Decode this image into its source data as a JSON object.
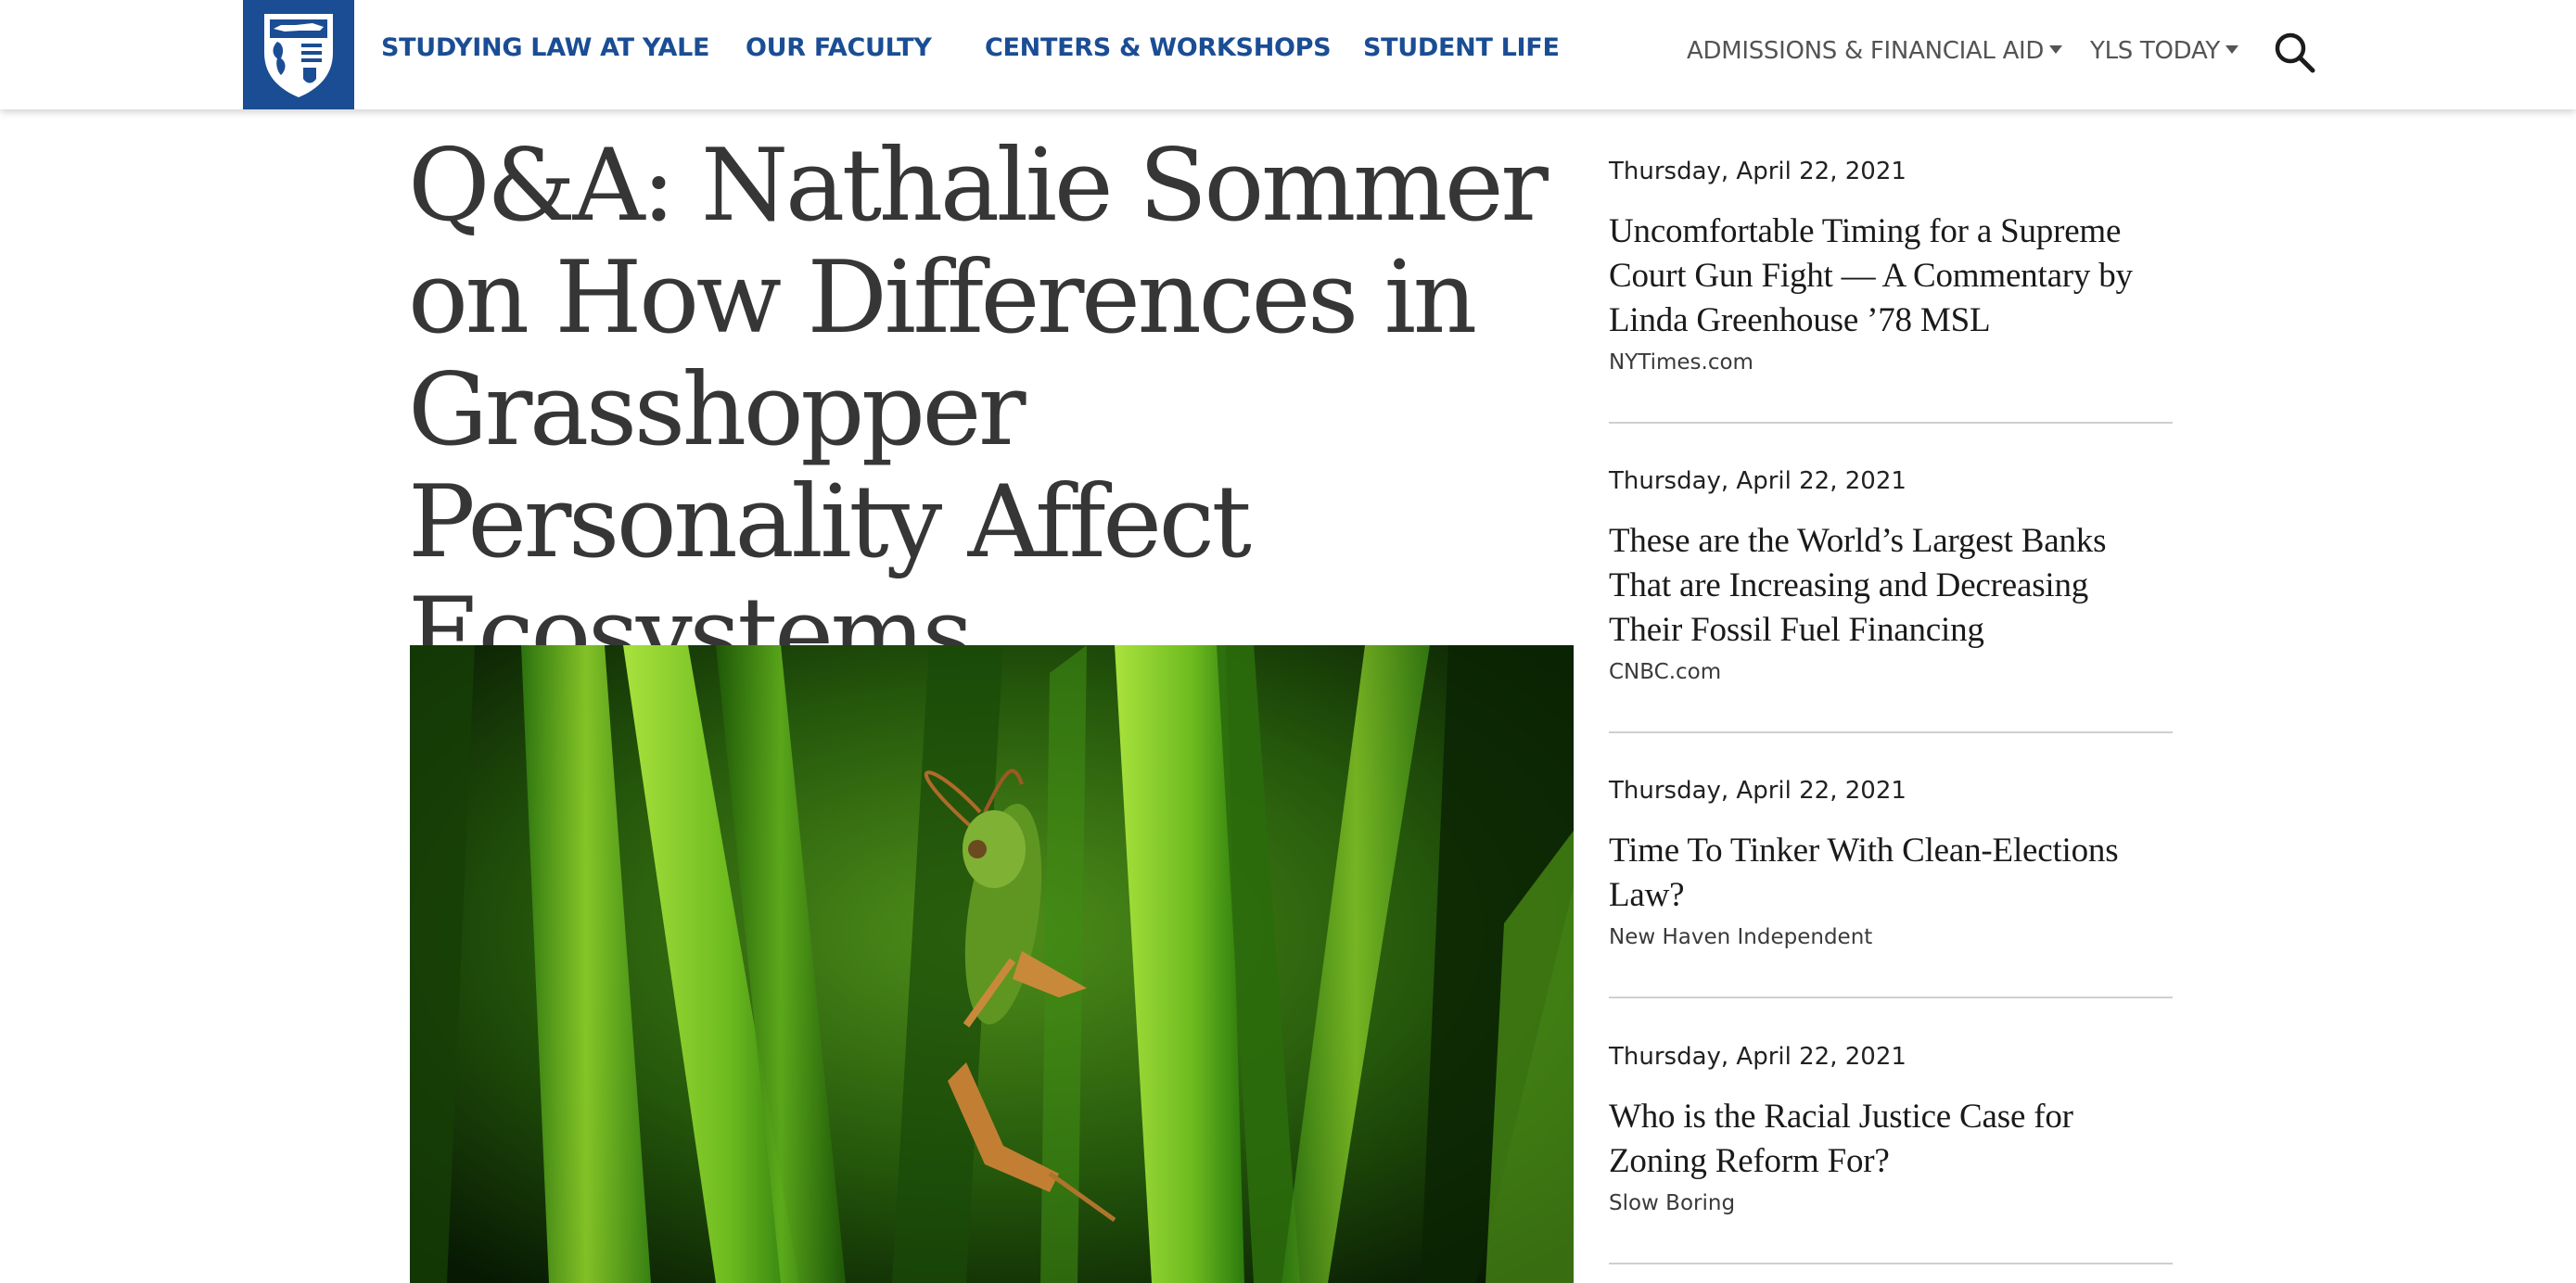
{
  "header": {
    "primary_nav": [
      {
        "label": "STUDYING LAW AT YALE"
      },
      {
        "label": "OUR FACULTY"
      },
      {
        "label": "CENTERS & WORKSHOPS"
      },
      {
        "label": "STUDENT LIFE"
      }
    ],
    "secondary_nav": [
      {
        "label": "ADMISSIONS & FINANCIAL AID",
        "icon": "chevron-down-icon"
      },
      {
        "label": "YLS TODAY",
        "icon": "chevron-down-icon"
      }
    ],
    "search_icon": "search-icon",
    "logo_icon": "yale-law-shield-icon",
    "colors": {
      "brand_blue": "#1a4d94",
      "secondary_text": "#545454"
    }
  },
  "article": {
    "title": "Q&A: Nathalie Sommer on How Differences in Grasshopper Personality Affect Ecosystems",
    "hero_image": "grasshopper-on-grass-photo"
  },
  "sidebar": {
    "items": [
      {
        "date": "Thursday, April 22, 2021",
        "headline": "Uncomfortable Timing for a Supreme Court Gun Fight — A Commentary by Linda Greenhouse ’78 MSL",
        "source": "NYTimes.com"
      },
      {
        "date": "Thursday, April 22, 2021",
        "headline": "These are the World’s Largest Banks That are Increasing and Decreasing Their Fossil Fuel Financing",
        "source": "CNBC.com"
      },
      {
        "date": "Thursday, April 22, 2021",
        "headline": "Time To Tinker With Clean-Elections Law?",
        "source": "New Haven Independent"
      },
      {
        "date": "Thursday, April 22, 2021",
        "headline": "Who is the Racial Justice Case for Zoning Reform For?",
        "source": "Slow Boring"
      }
    ]
  }
}
